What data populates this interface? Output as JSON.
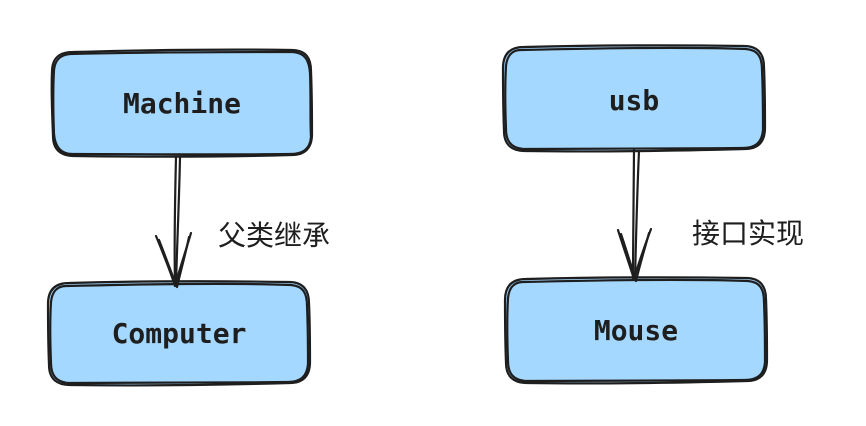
{
  "colors": {
    "node_fill": "#a5d8ff",
    "stroke": "#1e1e1e",
    "background": "#ffffff"
  },
  "nodes": {
    "machine": {
      "label": "Machine"
    },
    "computer": {
      "label": "Computer"
    },
    "usb": {
      "label": "usb"
    },
    "mouse": {
      "label": "Mouse"
    }
  },
  "edges": {
    "inheritance": {
      "label": "父类继承"
    },
    "implementation": {
      "label": "接口实现"
    }
  }
}
